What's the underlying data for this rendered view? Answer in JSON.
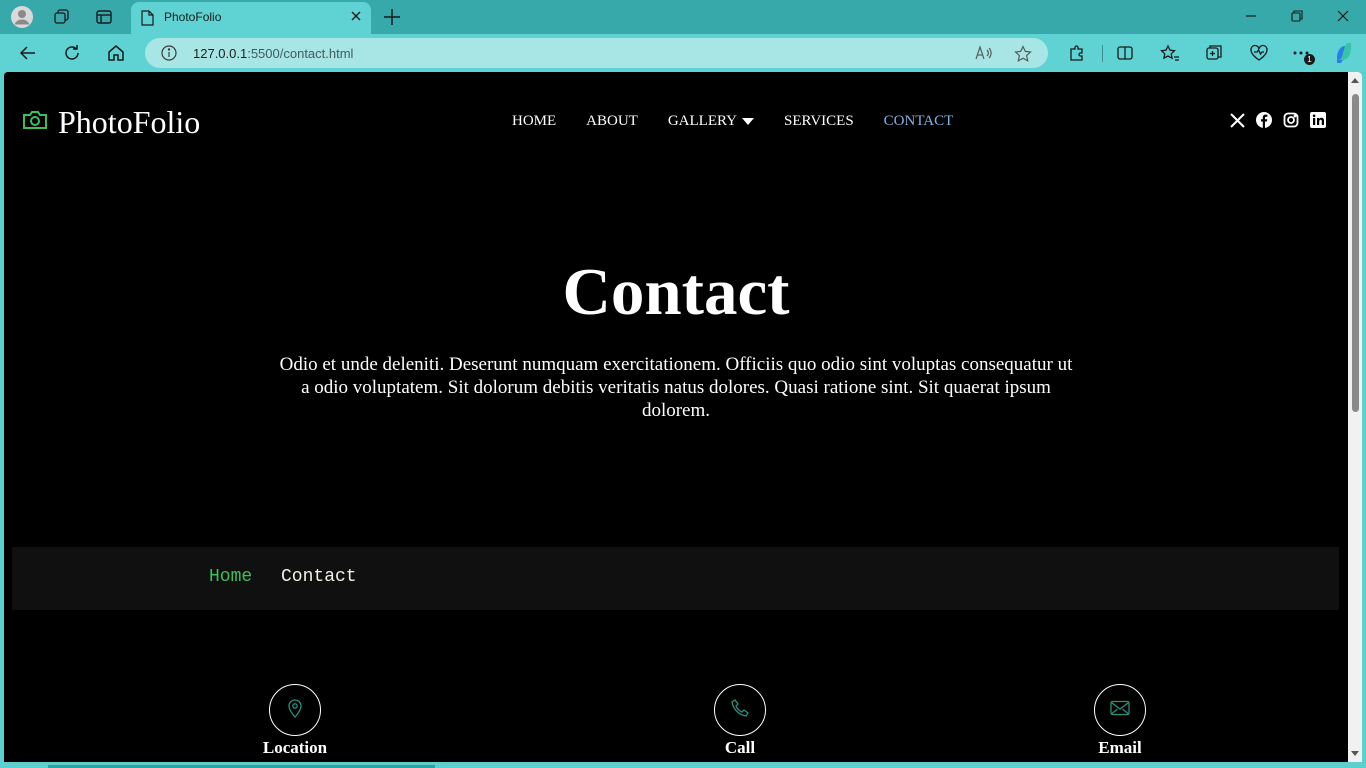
{
  "browser": {
    "tab_title": "PhotoFolio",
    "url_host": "127.0.0.1",
    "url_path": ":5500/contact.html",
    "extension_badge": "1",
    "accent_color": "#5fd3d3"
  },
  "site": {
    "logo_text": "PhotoFolio",
    "nav": [
      {
        "label": "HOME"
      },
      {
        "label": "ABOUT"
      },
      {
        "label": "GALLERY"
      },
      {
        "label": "SERVICES"
      },
      {
        "label": "CONTACT",
        "active": true
      }
    ],
    "socials": [
      "x-icon",
      "facebook-icon",
      "instagram-icon",
      "linkedin-icon"
    ],
    "accent_color": "#3cbf5a"
  },
  "hero": {
    "title": "Contact",
    "text": "Odio et unde deleniti. Deserunt numquam exercitationem. Officiis quo odio sint voluptas consequatur ut a odio voluptatem. Sit dolorum debitis veritatis natus dolores. Quasi ratione sint. Sit quaerat ipsum dolorem."
  },
  "breadcrumb": {
    "home": "Home",
    "current": "Contact"
  },
  "info_cards": [
    {
      "label": "Location",
      "icon": "map-pin-icon"
    },
    {
      "label": "Call",
      "icon": "phone-icon"
    },
    {
      "label": "Email",
      "icon": "envelope-icon"
    }
  ]
}
